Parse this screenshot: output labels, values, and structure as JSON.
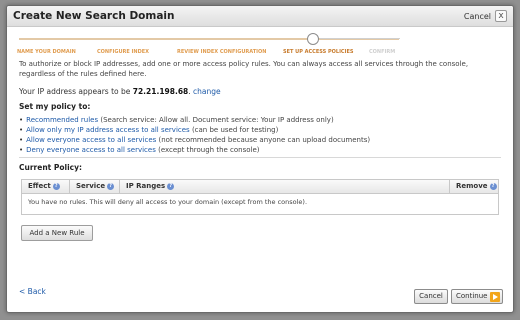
{
  "dialog": {
    "title": "Create New Search Domain",
    "cancel_label": "Cancel",
    "close_glyph": "x"
  },
  "steps": [
    {
      "label": "NAME YOUR DOMAIN",
      "state": "done"
    },
    {
      "label": "CONFIGURE INDEX",
      "state": "done"
    },
    {
      "label": "REVIEW INDEX CONFIGURATION",
      "state": "done"
    },
    {
      "label": "SET UP ACCESS POLICIES",
      "state": "current"
    },
    {
      "label": "CONFIRM",
      "state": "pending"
    }
  ],
  "intro": "To authorize or block IP addresses, add one or more access policy rules. You can always access all services through the console, regardless of the rules defined here.",
  "ip": {
    "prefix": "Your IP address appears to be",
    "address": "72.21.198.68",
    "change_link": "change"
  },
  "policy": {
    "heading": "Set my policy to:",
    "options": [
      {
        "link": "Recommended rules",
        "note": "(Search service: Allow all. Document service: Your IP address only)"
      },
      {
        "link": "Allow only my IP address access to all services",
        "note": "(can be used for testing)"
      },
      {
        "link": "Allow everyone access to all services",
        "note": "(not recommended because anyone can upload documents)"
      },
      {
        "link": "Deny everyone access to all services",
        "note": "(except through the console)"
      }
    ]
  },
  "current_policy": {
    "heading": "Current Policy:",
    "columns": [
      "Effect",
      "Service",
      "IP Ranges",
      "Remove"
    ],
    "empty_message": "You have no rules. This will deny all access to your domain (except from the console)."
  },
  "buttons": {
    "add_rule": "Add a New Rule",
    "back": "< Back",
    "cancel": "Cancel",
    "continue": "Continue"
  },
  "colors": {
    "accent_orange": "#e09c4f",
    "link_blue": "#1e5aa8"
  }
}
